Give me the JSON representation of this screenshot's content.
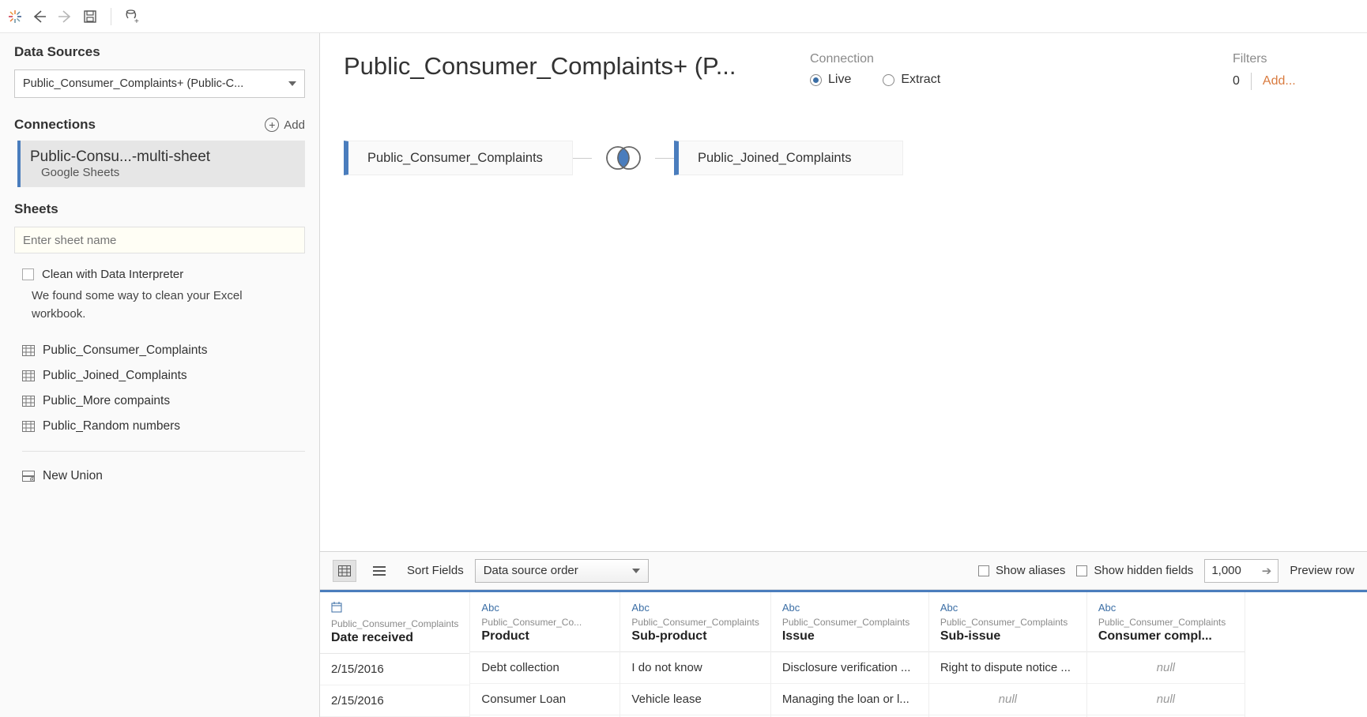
{
  "toolbar": {
    "back": "←",
    "forward": "→"
  },
  "left": {
    "data_sources_label": "Data Sources",
    "data_source_selected": "Public_Consumer_Complaints+ (Public-C...",
    "connections_label": "Connections",
    "add_label": "Add",
    "connection": {
      "title": "Public-Consu...-multi-sheet",
      "subtitle": "Google Sheets"
    },
    "sheets_label": "Sheets",
    "sheet_search_placeholder": "Enter sheet name",
    "clean_label": "Clean with Data Interpreter",
    "clean_hint": "We found some way to clean your Excel workbook.",
    "sheets": [
      "Public_Consumer_Complaints",
      "Public_Joined_Complaints",
      "Public_More compaints",
      "Public_Random numbers"
    ],
    "new_union": "New Union"
  },
  "header": {
    "title": "Public_Consumer_Complaints+ (P...",
    "connection_label": "Connection",
    "live_label": "Live",
    "extract_label": "Extract",
    "filters_label": "Filters",
    "filters_count": "0",
    "add_filter": "Add..."
  },
  "canvas": {
    "table_a": "Public_Consumer_Complaints",
    "table_b": "Public_Joined_Complaints"
  },
  "preview": {
    "sort_label": "Sort Fields",
    "sort_value": "Data source order",
    "show_aliases": "Show aliases",
    "show_hidden": "Show hidden fields",
    "rows": "1,000",
    "preview_rows_label": "Preview row"
  },
  "table": {
    "columns": [
      {
        "type": "date",
        "type_label": "",
        "source": "Public_Consumer_Complaints",
        "name": "Date received"
      },
      {
        "type": "abc",
        "type_label": "Abc",
        "source": "Public_Consumer_Co...",
        "name": "Product"
      },
      {
        "type": "abc",
        "type_label": "Abc",
        "source": "Public_Consumer_Complaints",
        "name": "Sub-product"
      },
      {
        "type": "abc",
        "type_label": "Abc",
        "source": "Public_Consumer_Complaints",
        "name": "Issue"
      },
      {
        "type": "abc",
        "type_label": "Abc",
        "source": "Public_Consumer_Complaints",
        "name": "Sub-issue"
      },
      {
        "type": "abc",
        "type_label": "Abc",
        "source": "Public_Consumer_Complaints",
        "name": "Consumer compl..."
      }
    ],
    "rows": [
      [
        "2/15/2016",
        "Debt collection",
        "I do not know",
        "Disclosure verification ...",
        "Right to dispute notice ...",
        "null"
      ],
      [
        "2/15/2016",
        "Consumer Loan",
        "Vehicle lease",
        "Managing the loan or l...",
        "null",
        "null"
      ]
    ]
  }
}
